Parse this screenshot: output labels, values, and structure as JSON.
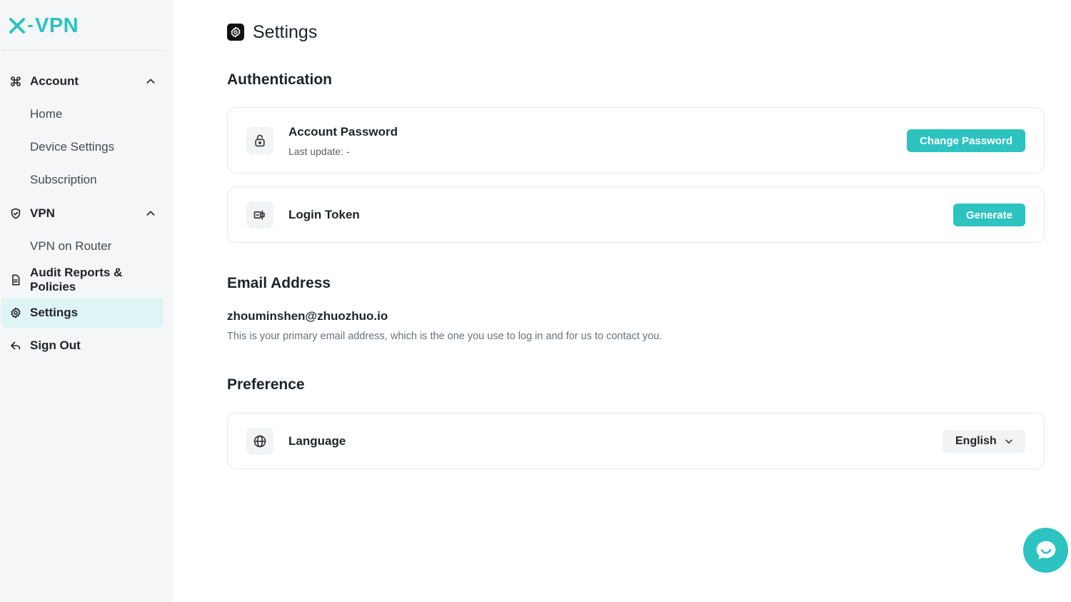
{
  "app": {
    "logo_text": "VPN",
    "brand_color": "#2cc3c0"
  },
  "sidebar": {
    "account": {
      "label": "Account",
      "icon": "command-icon",
      "expanded": true
    },
    "account_items": [
      {
        "label": "Home"
      },
      {
        "label": "Device Settings"
      },
      {
        "label": "Subscription"
      }
    ],
    "vpn": {
      "label": "VPN",
      "icon": "shield-icon",
      "expanded": true
    },
    "vpn_items": [
      {
        "label": "VPN on Router"
      }
    ],
    "audit": {
      "label": "Audit Reports & Policies",
      "icon": "document-icon"
    },
    "settings": {
      "label": "Settings",
      "icon": "gear-icon",
      "active": true
    },
    "signout": {
      "label": "Sign Out",
      "icon": "sign-out-icon"
    }
  },
  "main": {
    "title": "Settings",
    "authentication": {
      "section_title": "Authentication",
      "password": {
        "title": "Account Password",
        "subtitle": "Last update: -",
        "button": "Change Password",
        "icon": "lock-icon"
      },
      "token": {
        "title": "Login Token",
        "button": "Generate",
        "icon": "token-icon"
      }
    },
    "email": {
      "section_title": "Email Address",
      "address": "zhouminshen@zhuozhuo.io",
      "description": "This is your primary email address, which is the one you use to log in and for us to contact you."
    },
    "preference": {
      "section_title": "Preference",
      "language": {
        "title": "Language",
        "selected": "English",
        "icon": "globe-icon"
      }
    }
  },
  "chat": {
    "icon": "chat-icon"
  }
}
